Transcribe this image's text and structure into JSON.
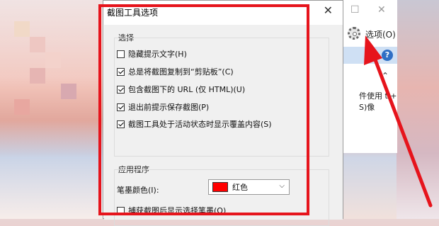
{
  "dialog": {
    "title": "截图工具选项",
    "section1_title": "选择",
    "options": [
      {
        "label": "隐藏提示文字(H)",
        "checked": false
      },
      {
        "label": "总是将截图复制到“剪贴板”(C)",
        "checked": true
      },
      {
        "label": "包含截图下的 URL (仅 HTML)(U)",
        "checked": true
      },
      {
        "label": "退出前提示保存截图(P)",
        "checked": true
      },
      {
        "label": "截图工具处于活动状态时显示覆盖内容(S)",
        "checked": true
      }
    ],
    "section2_title": "应用程序",
    "pen_color_label": "笔墨颜色(I):",
    "pen_color_value": "红色",
    "pen_color_hex": "#ff0000",
    "capture_option": {
      "label": "捕获截图后显示选择笔墨(O)",
      "checked": false
    },
    "close_icon": "close-icon"
  },
  "background_window": {
    "options_label": "选项(O)",
    "help_symbol": "?",
    "desc_text": "件使用 t + S)像"
  },
  "colors": {
    "annotation_red": "#e6141c",
    "dialog_bg": "#f0f0f0"
  }
}
